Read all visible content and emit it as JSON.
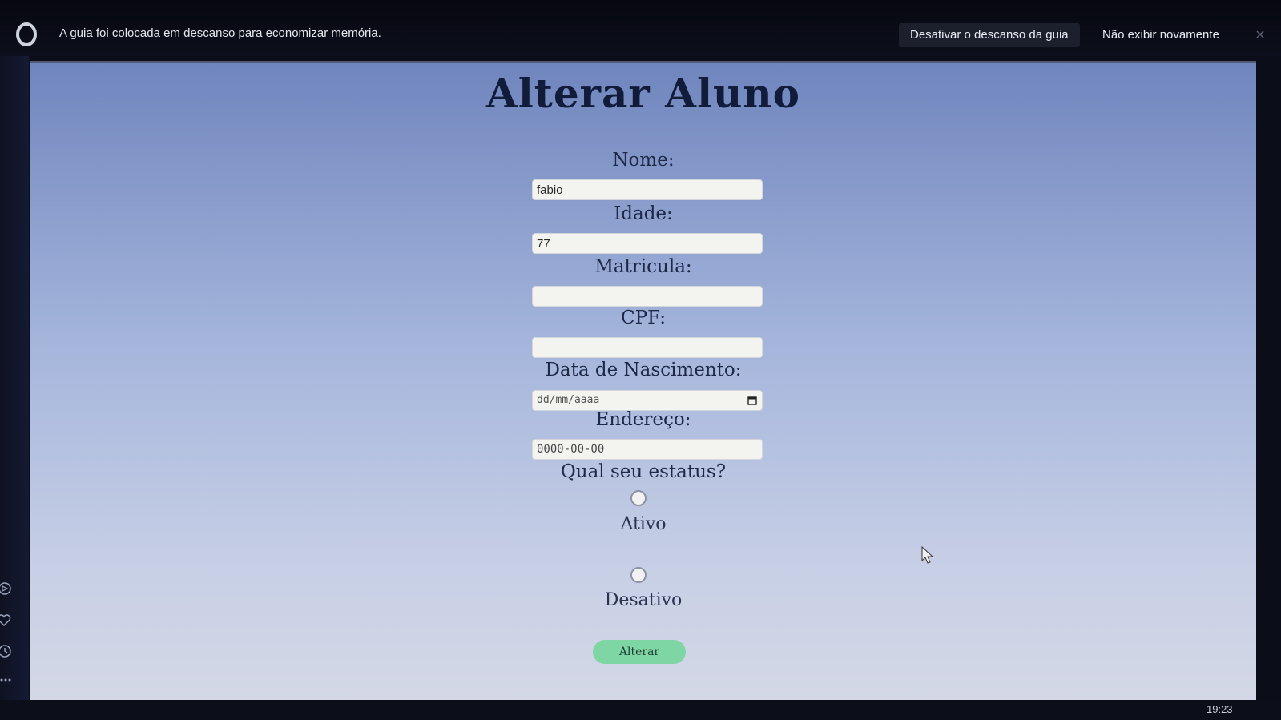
{
  "notification": {
    "message": "A guia foi colocada em descanso para economizar memória.",
    "disable_button": "Desativar o descanso da guia",
    "dont_show_button": "Não exibir novamente"
  },
  "page": {
    "title": "Alterar Aluno"
  },
  "form": {
    "nome": {
      "label": "Nome:",
      "value": "fabio"
    },
    "idade": {
      "label": "Idade:",
      "value": "77"
    },
    "matricula": {
      "label": "Matricula:",
      "value": ""
    },
    "cpf": {
      "label": "CPF:",
      "value": ""
    },
    "nascimento": {
      "label": "Data de Nascimento:",
      "placeholder": "dd/mm/aaaa"
    },
    "endereco": {
      "label": "Endereço:",
      "value": "0000-00-00"
    },
    "status": {
      "question": "Qual seu estatus?",
      "options": [
        "Ativo",
        "Desativo"
      ]
    },
    "submit_label": "Alterar"
  },
  "taskbar": {
    "clock": "19:23"
  },
  "icons": {
    "logo": "opera-logo-icon",
    "calendar": "calendar-icon",
    "cursor": "mouse-pointer-icon"
  }
}
